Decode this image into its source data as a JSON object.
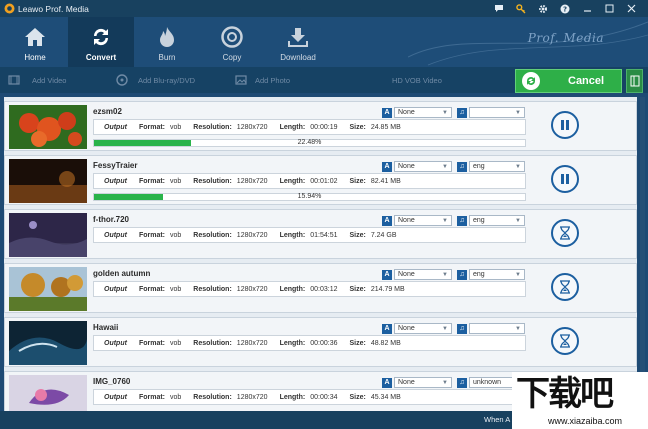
{
  "app": {
    "title": "Leawo Prof. Media",
    "brand": "Prof. Media"
  },
  "toolbar": {
    "home": "Home",
    "convert": "Convert",
    "burn": "Burn",
    "copy": "Copy",
    "download": "Download"
  },
  "subbar": {
    "add_video": "Add Video",
    "add_bluray": "Add Blu-ray/DVD",
    "add_photo": "Add Photo",
    "hd_vob": "HD VOB Video"
  },
  "cancel_label": "Cancel",
  "labels": {
    "output": "Output",
    "format": "Format:",
    "resolution": "Resolution:",
    "length": "Length:",
    "size": "Size:"
  },
  "rows": [
    {
      "name": "ezsm02",
      "format": "vob",
      "resolution": "1280x720",
      "length": "00:00:19",
      "size": "24.85 MB",
      "subtitle": "None",
      "audio": "",
      "progress_text": "22.48%",
      "progress": 0.2248,
      "state": "pause"
    },
    {
      "name": "FessyTraier",
      "format": "vob",
      "resolution": "1280x720",
      "length": "00:01:02",
      "size": "82.41 MB",
      "subtitle": "None",
      "audio": "eng",
      "progress_text": "15.94%",
      "progress": 0.1594,
      "state": "pause"
    },
    {
      "name": "f-thor.720",
      "format": "vob",
      "resolution": "1280x720",
      "length": "01:54:51",
      "size": "7.24 GB",
      "subtitle": "None",
      "audio": "eng",
      "progress_text": "",
      "progress": 0,
      "state": "waiting"
    },
    {
      "name": "golden autumn",
      "format": "vob",
      "resolution": "1280x720",
      "length": "00:03:12",
      "size": "214.79 MB",
      "subtitle": "None",
      "audio": "eng",
      "progress_text": "",
      "progress": 0,
      "state": "waiting"
    },
    {
      "name": "Hawaii",
      "format": "vob",
      "resolution": "1280x720",
      "length": "00:00:36",
      "size": "48.82 MB",
      "subtitle": "None",
      "audio": "",
      "progress_text": "",
      "progress": 0,
      "state": "waiting"
    },
    {
      "name": "IMG_0760",
      "format": "vob",
      "resolution": "1280x720",
      "length": "00:00:34",
      "size": "45.34 MB",
      "subtitle": "None",
      "audio": "unknown",
      "progress_text": "",
      "progress": 0,
      "state": "waiting"
    }
  ],
  "bottom": {
    "when_text": "When A"
  },
  "watermark": {
    "big": "下载吧",
    "small": "www.xiazaiba.com"
  },
  "colors": {
    "accent": "#1c5fa0",
    "progress": "#29b34a",
    "cancel": "#2eaf48"
  }
}
